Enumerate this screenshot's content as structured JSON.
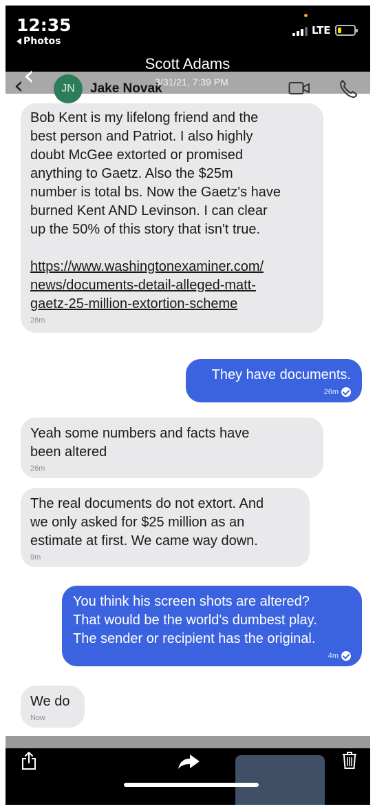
{
  "status_bar": {
    "time": "12:35",
    "back_label": "Photos",
    "network": "LTE"
  },
  "header": {
    "title": "Scott Adams",
    "contact_initials": "JN",
    "contact_name": "Jake Novak",
    "timestamp": "3/31/21, 7:39 PM"
  },
  "messages": [
    {
      "direction": "incoming",
      "text": "Bob Kent is my lifelong friend and the\nbest person and Patriot. I also highly\ndoubt McGee extorted or promised\nanything to Gaetz. Also the $25m\nnumber is total bs. Now the Gaetz's have\nburned Kent AND Levinson. I can clear\nup the 50% of this story that isn't true.",
      "link": "https://www.washingtonexaminer.com/\nnews/documents-detail-alleged-matt-\ngaetz-25-million-extortion-scheme",
      "time": "28m"
    },
    {
      "direction": "outgoing",
      "text": "They have documents.",
      "time": "26m"
    },
    {
      "direction": "incoming",
      "text": "Yeah some numbers and facts have\nbeen altered",
      "time": "26m"
    },
    {
      "direction": "incoming",
      "text": "The real documents do not extort. And\nwe only asked for $25 million as an\nestimate at first. We came way down.",
      "time": "9m"
    },
    {
      "direction": "outgoing",
      "text": "You think his screen shots are altered?\nThat would be the world's dumbest play.\nThe sender or recipient has the original.",
      "time": "4m"
    },
    {
      "direction": "incoming",
      "text": "We do",
      "time": "Now"
    }
  ],
  "icons": {
    "back": "chevron-left-icon",
    "video": "video-camera-icon",
    "phone": "phone-icon",
    "share": "share-icon",
    "forward": "forward-arrow-icon",
    "trash": "trash-icon",
    "read": "read-receipt-icon"
  },
  "colors": {
    "incoming_bubble": "#e9e9eb",
    "outgoing_bubble": "#3b63e0",
    "avatar": "#2e7d5a"
  }
}
